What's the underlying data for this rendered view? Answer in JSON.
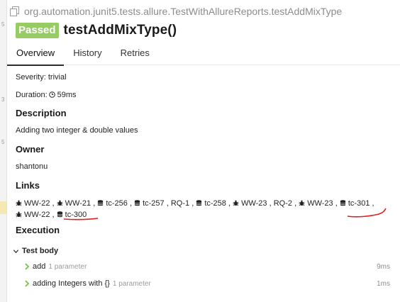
{
  "header": {
    "path": "org.automation.junit5.tests.allure.TestWithAllureReports.testAddMixType",
    "status": "Passed",
    "title": "testAddMixType()"
  },
  "tabs": [
    {
      "label": "Overview",
      "active": true
    },
    {
      "label": "History",
      "active": false
    },
    {
      "label": "Retries",
      "active": false
    }
  ],
  "overview": {
    "severity": "Severity: trivial",
    "duration_prefix": "Duration:",
    "duration_value": "59ms"
  },
  "description": {
    "heading": "Description",
    "text": "Adding two integer & double values"
  },
  "owner": {
    "heading": "Owner",
    "text": "shantonu"
  },
  "links": {
    "heading": "Links",
    "items": [
      {
        "label": "WW-22",
        "icon": "bug-icon"
      },
      {
        "label": "WW-21",
        "icon": "bug-icon"
      },
      {
        "label": "tc-256",
        "icon": "database-icon"
      },
      {
        "label": "tc-257",
        "icon": "database-icon"
      },
      {
        "label": "RQ-1",
        "icon": "none"
      },
      {
        "label": "tc-258",
        "icon": "database-icon"
      },
      {
        "label": "WW-23",
        "icon": "bug-icon"
      },
      {
        "label": "RQ-2",
        "icon": "none"
      },
      {
        "label": "WW-23",
        "icon": "bug-icon"
      },
      {
        "label": "tc-301",
        "icon": "database-icon"
      },
      {
        "label": "WW-22",
        "icon": "bug-icon"
      },
      {
        "label": "tc-300",
        "icon": "database-icon"
      }
    ],
    "separator": ","
  },
  "execution": {
    "heading": "Execution",
    "test_body_label": "Test body",
    "steps": [
      {
        "name": "add",
        "params": "1 parameter",
        "time": "9ms"
      },
      {
        "name": "adding Integers with {}",
        "params": "1 parameter",
        "time": "1ms"
      }
    ]
  },
  "colors": {
    "passed": "#97cc64",
    "annotation_red": "#e02020",
    "step_chevron": "#7bbf4a"
  }
}
